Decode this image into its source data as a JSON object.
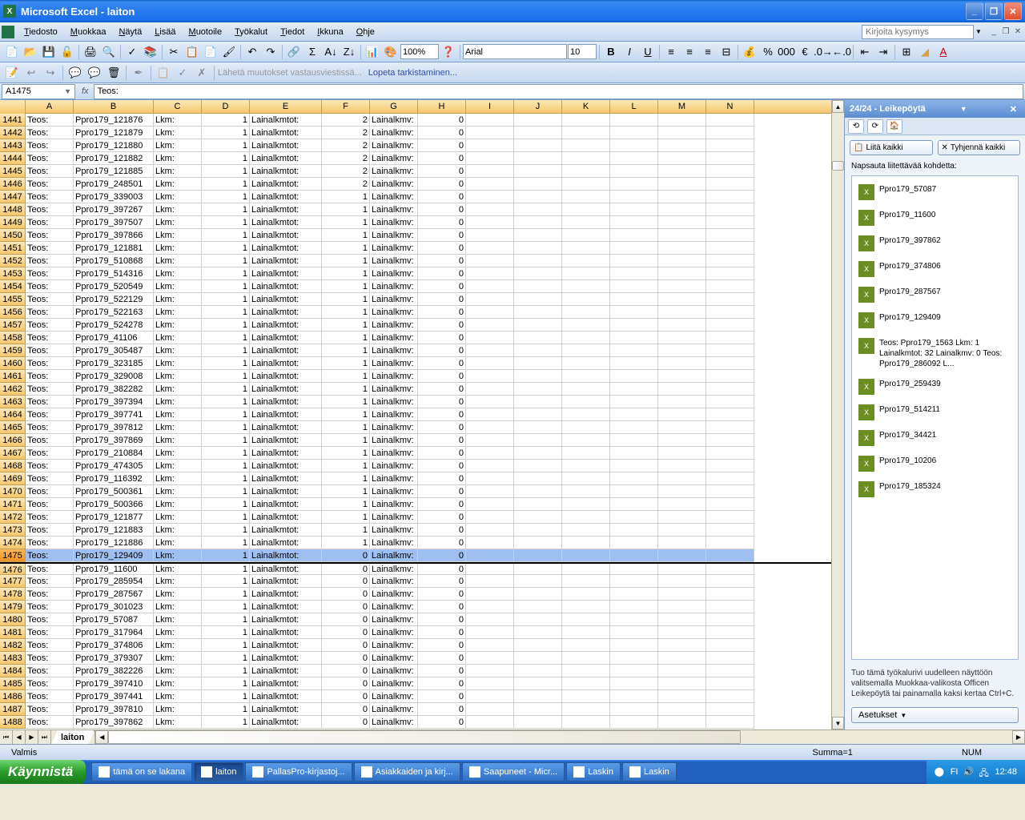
{
  "app": {
    "title": "Microsoft Excel - laiton"
  },
  "menu": {
    "items": [
      "Tiedosto",
      "Muokkaa",
      "Näytä",
      "Lisää",
      "Muotoile",
      "Työkalut",
      "Tiedot",
      "Ikkuna",
      "Ohje"
    ],
    "help_placeholder": "Kirjoita kysymys"
  },
  "toolbar": {
    "zoom": "100%",
    "font": "Arial",
    "size": "10"
  },
  "review": {
    "send": "Lähetä muutokset vastausviestissä...",
    "end": "Lopeta tarkistaminen..."
  },
  "formula": {
    "name_box": "A1475",
    "fx": "fx",
    "value": "Teos:"
  },
  "columns": [
    "A",
    "B",
    "C",
    "D",
    "E",
    "F",
    "G",
    "H",
    "I",
    "J",
    "K",
    "L",
    "M",
    "N"
  ],
  "first_row": 1441,
  "selected_row": 1475,
  "rows": [
    {
      "b": "Ppro179_121876",
      "f": 2,
      "h": 0
    },
    {
      "b": "Ppro179_121879",
      "f": 2,
      "h": 0
    },
    {
      "b": "Ppro179_121880",
      "f": 2,
      "h": 0
    },
    {
      "b": "Ppro179_121882",
      "f": 2,
      "h": 0
    },
    {
      "b": "Ppro179_121885",
      "f": 2,
      "h": 0
    },
    {
      "b": "Ppro179_248501",
      "f": 2,
      "h": 0
    },
    {
      "b": "Ppro179_339003",
      "f": 1,
      "h": 0
    },
    {
      "b": "Ppro179_397267",
      "f": 1,
      "h": 0
    },
    {
      "b": "Ppro179_397507",
      "f": 1,
      "h": 0
    },
    {
      "b": "Ppro179_397866",
      "f": 1,
      "h": 0
    },
    {
      "b": "Ppro179_121881",
      "f": 1,
      "h": 0
    },
    {
      "b": "Ppro179_510868",
      "f": 1,
      "h": 0
    },
    {
      "b": "Ppro179_514316",
      "f": 1,
      "h": 0
    },
    {
      "b": "Ppro179_520549",
      "f": 1,
      "h": 0
    },
    {
      "b": "Ppro179_522129",
      "f": 1,
      "h": 0
    },
    {
      "b": "Ppro179_522163",
      "f": 1,
      "h": 0
    },
    {
      "b": "Ppro179_524278",
      "f": 1,
      "h": 0
    },
    {
      "b": "Ppro179_41106",
      "f": 1,
      "h": 0
    },
    {
      "b": "Ppro179_305487",
      "f": 1,
      "h": 0
    },
    {
      "b": "Ppro179_323185",
      "f": 1,
      "h": 0
    },
    {
      "b": "Ppro179_329008",
      "f": 1,
      "h": 0
    },
    {
      "b": "Ppro179_382282",
      "f": 1,
      "h": 0
    },
    {
      "b": "Ppro179_397394",
      "f": 1,
      "h": 0
    },
    {
      "b": "Ppro179_397741",
      "f": 1,
      "h": 0
    },
    {
      "b": "Ppro179_397812",
      "f": 1,
      "h": 0
    },
    {
      "b": "Ppro179_397869",
      "f": 1,
      "h": 0
    },
    {
      "b": "Ppro179_210884",
      "f": 1,
      "h": 0
    },
    {
      "b": "Ppro179_474305",
      "f": 1,
      "h": 0
    },
    {
      "b": "Ppro179_116392",
      "f": 1,
      "h": 0
    },
    {
      "b": "Ppro179_500361",
      "f": 1,
      "h": 0
    },
    {
      "b": "Ppro179_500366",
      "f": 1,
      "h": 0
    },
    {
      "b": "Ppro179_121877",
      "f": 1,
      "h": 0
    },
    {
      "b": "Ppro179_121883",
      "f": 1,
      "h": 0
    },
    {
      "b": "Ppro179_121886",
      "f": 1,
      "h": 0
    },
    {
      "b": "Ppro179_129409",
      "f": 0,
      "h": 0
    },
    {
      "b": "Ppro179_11600",
      "f": 0,
      "h": 0
    },
    {
      "b": "Ppro179_285954",
      "f": 0,
      "h": 0
    },
    {
      "b": "Ppro179_287567",
      "f": 0,
      "h": 0
    },
    {
      "b": "Ppro179_301023",
      "f": 0,
      "h": 0
    },
    {
      "b": "Ppro179_57087",
      "f": 0,
      "h": 0
    },
    {
      "b": "Ppro179_317964",
      "f": 0,
      "h": 0
    },
    {
      "b": "Ppro179_374806",
      "f": 0,
      "h": 0
    },
    {
      "b": "Ppro179_379307",
      "f": 0,
      "h": 0
    },
    {
      "b": "Ppro179_382226",
      "f": 0,
      "h": 0
    },
    {
      "b": "Ppro179_397410",
      "f": 0,
      "h": 0
    },
    {
      "b": "Ppro179_397441",
      "f": 0,
      "h": 0
    },
    {
      "b": "Ppro179_397810",
      "f": 0,
      "h": 0
    },
    {
      "b": "Ppro179_397862",
      "f": 0,
      "h": 0
    }
  ],
  "labels": {
    "teos": "Teos:",
    "lkm": "Lkm:",
    "lkm_val": "1",
    "lainatot": "Lainalkmtot:",
    "lainakmv": "Lainalkmv:"
  },
  "sheet": {
    "name": "laiton"
  },
  "status": {
    "ready": "Valmis",
    "sum": "Summa=1",
    "num": "NUM"
  },
  "clipboard": {
    "title": "24/24 - Leikepöytä",
    "paste_all": "Liitä kaikki",
    "clear_all": "Tyhjennä kaikki",
    "caption": "Napsauta liitettävää kohdetta:",
    "items": [
      "Ppro179_57087",
      "Ppro179_11600",
      "Ppro179_397862",
      "Ppro179_374806",
      "Ppro179_287567",
      "Ppro179_129409",
      "Teos: Ppro179_1563 Lkm: 1 Lainalkmtot: 32 Lainalkmv: 0 Teos: Ppro179_286092 L...",
      "Ppro179_259439",
      "Ppro179_514211",
      "Ppro179_34421",
      "Ppro179_10206",
      "Ppro179_185324"
    ],
    "footer": "Tuo tämä työkalurivi uudelleen näyttöön valitsemalla Muokkaa-valikosta Officen Leikepöytä tai painamalla kaksi kertaa Ctrl+C.",
    "options": "Asetukset"
  },
  "taskbar": {
    "start": "Käynnistä",
    "tasks": [
      {
        "label": "tämä on se lakana",
        "active": false
      },
      {
        "label": "laiton",
        "active": true
      },
      {
        "label": "PallasPro-kirjastoj...",
        "active": false
      },
      {
        "label": "Asiakkaiden ja kirj...",
        "active": false
      },
      {
        "label": "Saapuneet - Micr...",
        "active": false
      },
      {
        "label": "Laskin",
        "active": false
      },
      {
        "label": "Laskin",
        "active": false
      }
    ],
    "lang": "FI",
    "time": "12:48"
  }
}
